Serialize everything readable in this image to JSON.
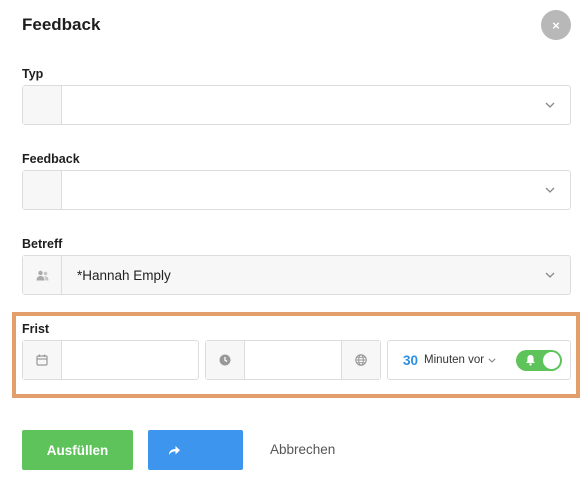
{
  "dialog": {
    "title": "Feedback",
    "close_label": "×"
  },
  "fields": {
    "typ": {
      "label": "Typ",
      "value": ""
    },
    "feedback": {
      "label": "Feedback",
      "value": ""
    },
    "betreff": {
      "label": "Betreff",
      "value": "*Hannah Emply"
    }
  },
  "frist": {
    "label": "Frist",
    "date_value": "",
    "time_value": "",
    "reminder_amount": "30",
    "reminder_unit": "Minuten vor",
    "reminder_enabled": true
  },
  "actions": {
    "fill_label": "Ausfüllen",
    "cancel_label": "Abbrechen"
  },
  "colors": {
    "primary_green": "#5dc35a",
    "share_blue": "#3d95ee",
    "highlight_orange": "#e29f6c",
    "accent_number": "#2f8fe0"
  },
  "icons": {
    "close": "close-icon",
    "chevron": "chevron-down-icon",
    "contacts": "contacts-icon",
    "calendar": "calendar-icon",
    "clock": "clock-icon",
    "globe": "globe-icon",
    "bell": "bell-icon",
    "share": "share-arrow-icon"
  }
}
